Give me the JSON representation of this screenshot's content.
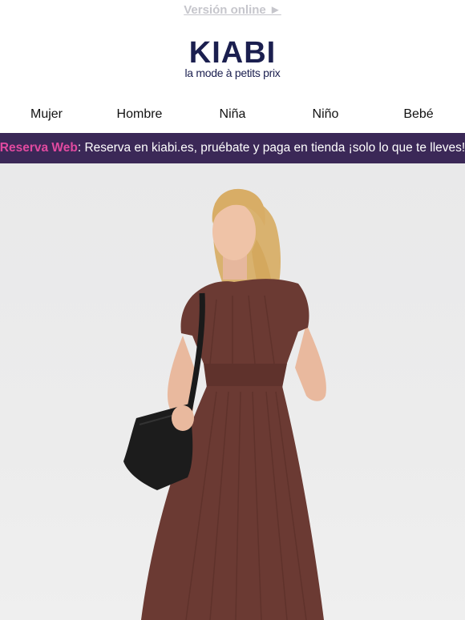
{
  "header": {
    "online_version": "Versión online ►"
  },
  "logo": {
    "brand": "KIABI",
    "tagline": "la mode à petits prix"
  },
  "nav": {
    "items": [
      {
        "label": "Mujer"
      },
      {
        "label": "Hombre"
      },
      {
        "label": "Niña"
      },
      {
        "label": "Niño"
      },
      {
        "label": "Bebé"
      }
    ]
  },
  "banner": {
    "highlight": "Reserva Web",
    "text": ": Reserva en kiabi.es, pruébate y paga en tienda ¡solo lo que te lleves!",
    "background": "#3b2857",
    "accent": "#e14aa0"
  },
  "hero": {
    "dress_color": "#6b3a33"
  }
}
